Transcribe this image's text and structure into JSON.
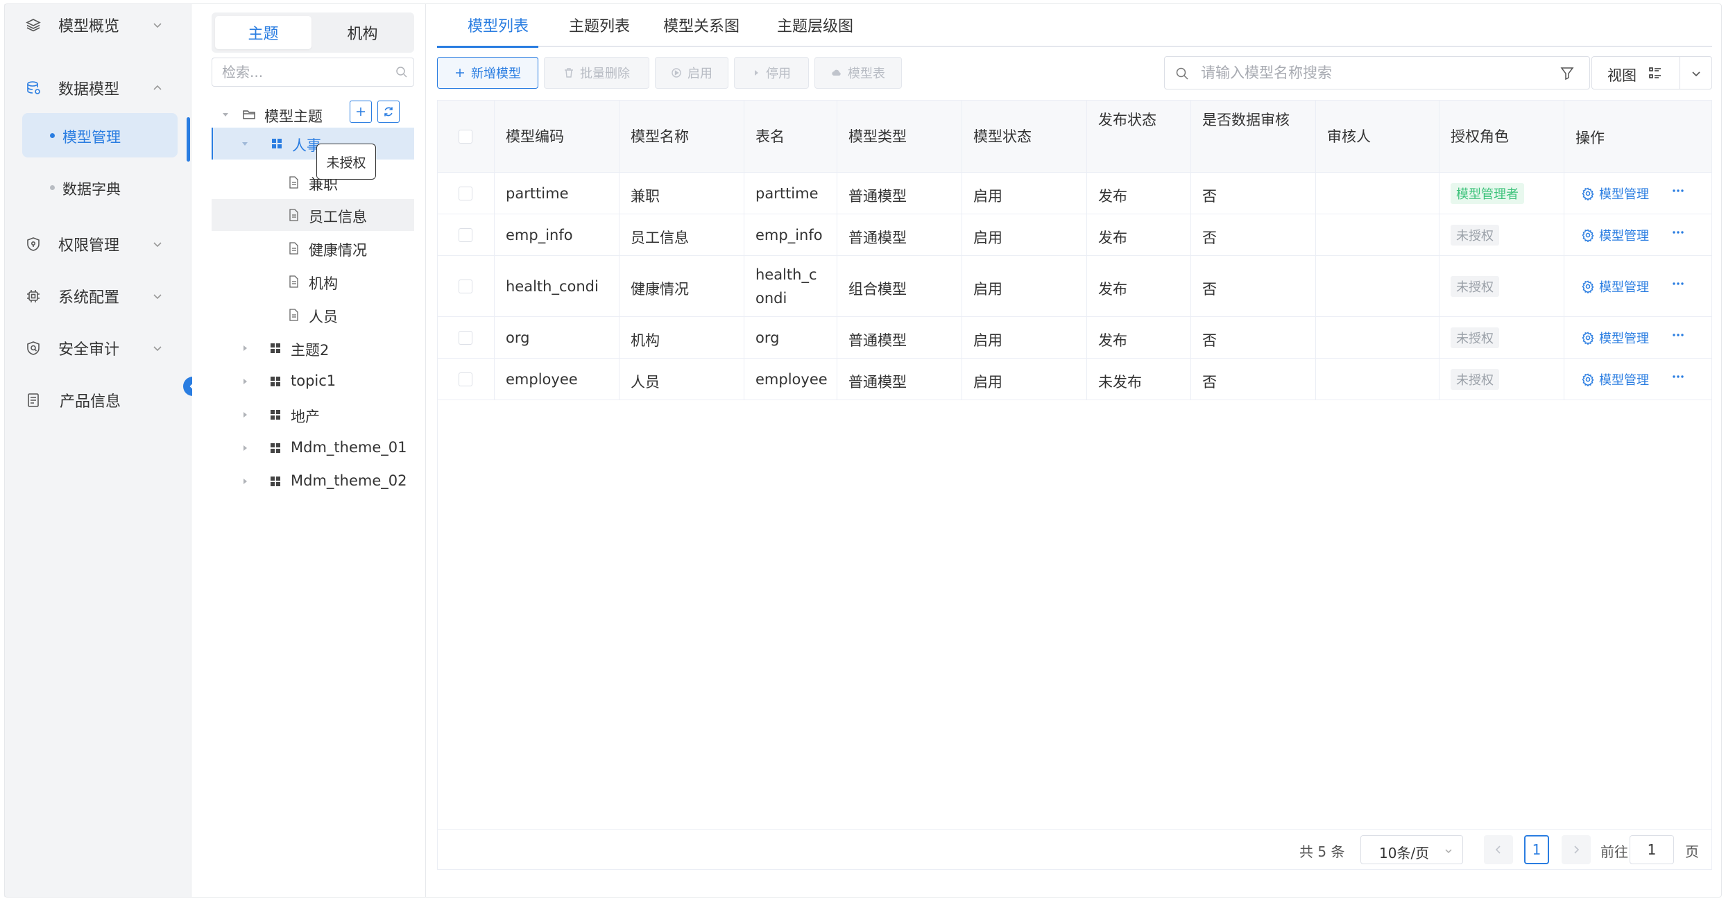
{
  "sidebar": {
    "items": [
      {
        "label": "模型概览",
        "icon": "layers-icon"
      },
      {
        "label": "数据模型",
        "icon": "database-icon",
        "expanded": true
      },
      {
        "label": "权限管理",
        "icon": "shield-icon"
      },
      {
        "label": "系统配置",
        "icon": "chip-icon"
      },
      {
        "label": "安全审计",
        "icon": "shield-check-icon"
      },
      {
        "label": "产品信息",
        "icon": "document-icon"
      }
    ],
    "sub_items": [
      {
        "label": "模型管理",
        "active": true
      },
      {
        "label": "数据字典",
        "active": false
      }
    ]
  },
  "tree": {
    "segment_tabs": [
      "主题",
      "机构"
    ],
    "active_segment": "主题",
    "search_placeholder": "检索...",
    "root_label": "模型主题",
    "tooltip": "未授权",
    "nodes": [
      {
        "label": "人事",
        "type": "group",
        "expanded": true,
        "selected": true
      },
      {
        "label": "兼职",
        "type": "file"
      },
      {
        "label": "员工信息",
        "type": "file",
        "hover": true
      },
      {
        "label": "健康情况",
        "type": "file"
      },
      {
        "label": "机构",
        "type": "file"
      },
      {
        "label": "人员",
        "type": "file"
      },
      {
        "label": "主题2",
        "type": "group"
      },
      {
        "label": "topic1",
        "type": "group"
      },
      {
        "label": "地产",
        "type": "group"
      },
      {
        "label": "Mdm_theme_01",
        "type": "group"
      },
      {
        "label": "Mdm_theme_02",
        "type": "group"
      }
    ]
  },
  "tabs": [
    "模型列表",
    "主题列表",
    "模型关系图",
    "主题层级图"
  ],
  "toolbar": {
    "add": "新增模型",
    "batch_delete": "批量删除",
    "enable": "启用",
    "disable": "停用",
    "model_table": "模型表"
  },
  "search": {
    "placeholder": "请输入模型名称搜索",
    "value": ""
  },
  "view": {
    "label": "视图"
  },
  "table": {
    "columns": [
      "模型编码",
      "模型名称",
      "表名",
      "模型类型",
      "模型状态",
      "发布状态",
      "是否数据审核",
      "审核人",
      "授权角色",
      "操作"
    ],
    "rows": [
      {
        "code": "parttime",
        "name": "兼职",
        "table": "parttime",
        "type": "普通模型",
        "status": "启用",
        "publish": "发布",
        "audit": "否",
        "auditor": "",
        "role": "模型管理者",
        "role_style": "green",
        "op": "模型管理"
      },
      {
        "code": "emp_info",
        "name": "员工信息",
        "table": "emp_info",
        "type": "普通模型",
        "status": "启用",
        "publish": "发布",
        "audit": "否",
        "auditor": "",
        "role": "未授权",
        "role_style": "gray",
        "op": "模型管理"
      },
      {
        "code": "health_condi",
        "name": "健康情况",
        "table": "health_condi",
        "table_lines": [
          "health_c",
          "ondi"
        ],
        "type": "组合模型",
        "status": "启用",
        "publish": "发布",
        "audit": "否",
        "auditor": "",
        "role": "未授权",
        "role_style": "gray",
        "op": "模型管理"
      },
      {
        "code": "org",
        "name": "机构",
        "table": "org",
        "type": "普通模型",
        "status": "启用",
        "publish": "发布",
        "audit": "否",
        "auditor": "",
        "role": "未授权",
        "role_style": "gray",
        "op": "模型管理"
      },
      {
        "code": "employee",
        "name": "人员",
        "table": "employee",
        "type": "普通模型",
        "status": "启用",
        "publish": "未发布",
        "audit": "否",
        "auditor": "",
        "role": "未授权",
        "role_style": "gray",
        "op": "模型管理"
      }
    ]
  },
  "pager": {
    "total": "共 5 条",
    "page_size": "10条/页",
    "current_page": "1",
    "goto_label": "前往",
    "goto_value": "1",
    "page_unit": "页"
  },
  "colors": {
    "accent": "#2a7de1",
    "success": "#3cc27a",
    "sidebar_bg": "#f3f4f6",
    "selected_bg": "#dde9f7"
  }
}
